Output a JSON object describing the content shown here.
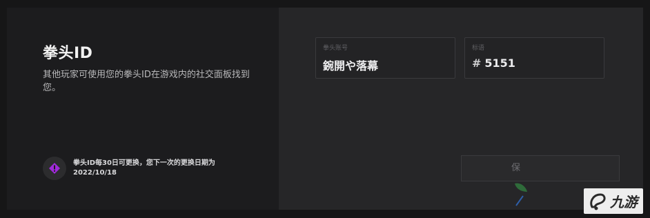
{
  "panel": {
    "title": "拳头ID",
    "description": "其他玩家可使用您的拳头ID在游戏内的社交面板找到您。",
    "notice": "拳头ID每30日可更换，您下一次的更换日期为 2022/10/18",
    "notice_icon": "warning-diamond-icon",
    "accent_color": "#a02ad9"
  },
  "form": {
    "riot_id_label": "拳头账号",
    "riot_id_value": "鋺開や落幕",
    "tagline_label": "标语",
    "tagline_hash": "#",
    "tagline_value": "5151",
    "save_label": "保"
  },
  "watermark": {
    "text": "九游"
  }
}
